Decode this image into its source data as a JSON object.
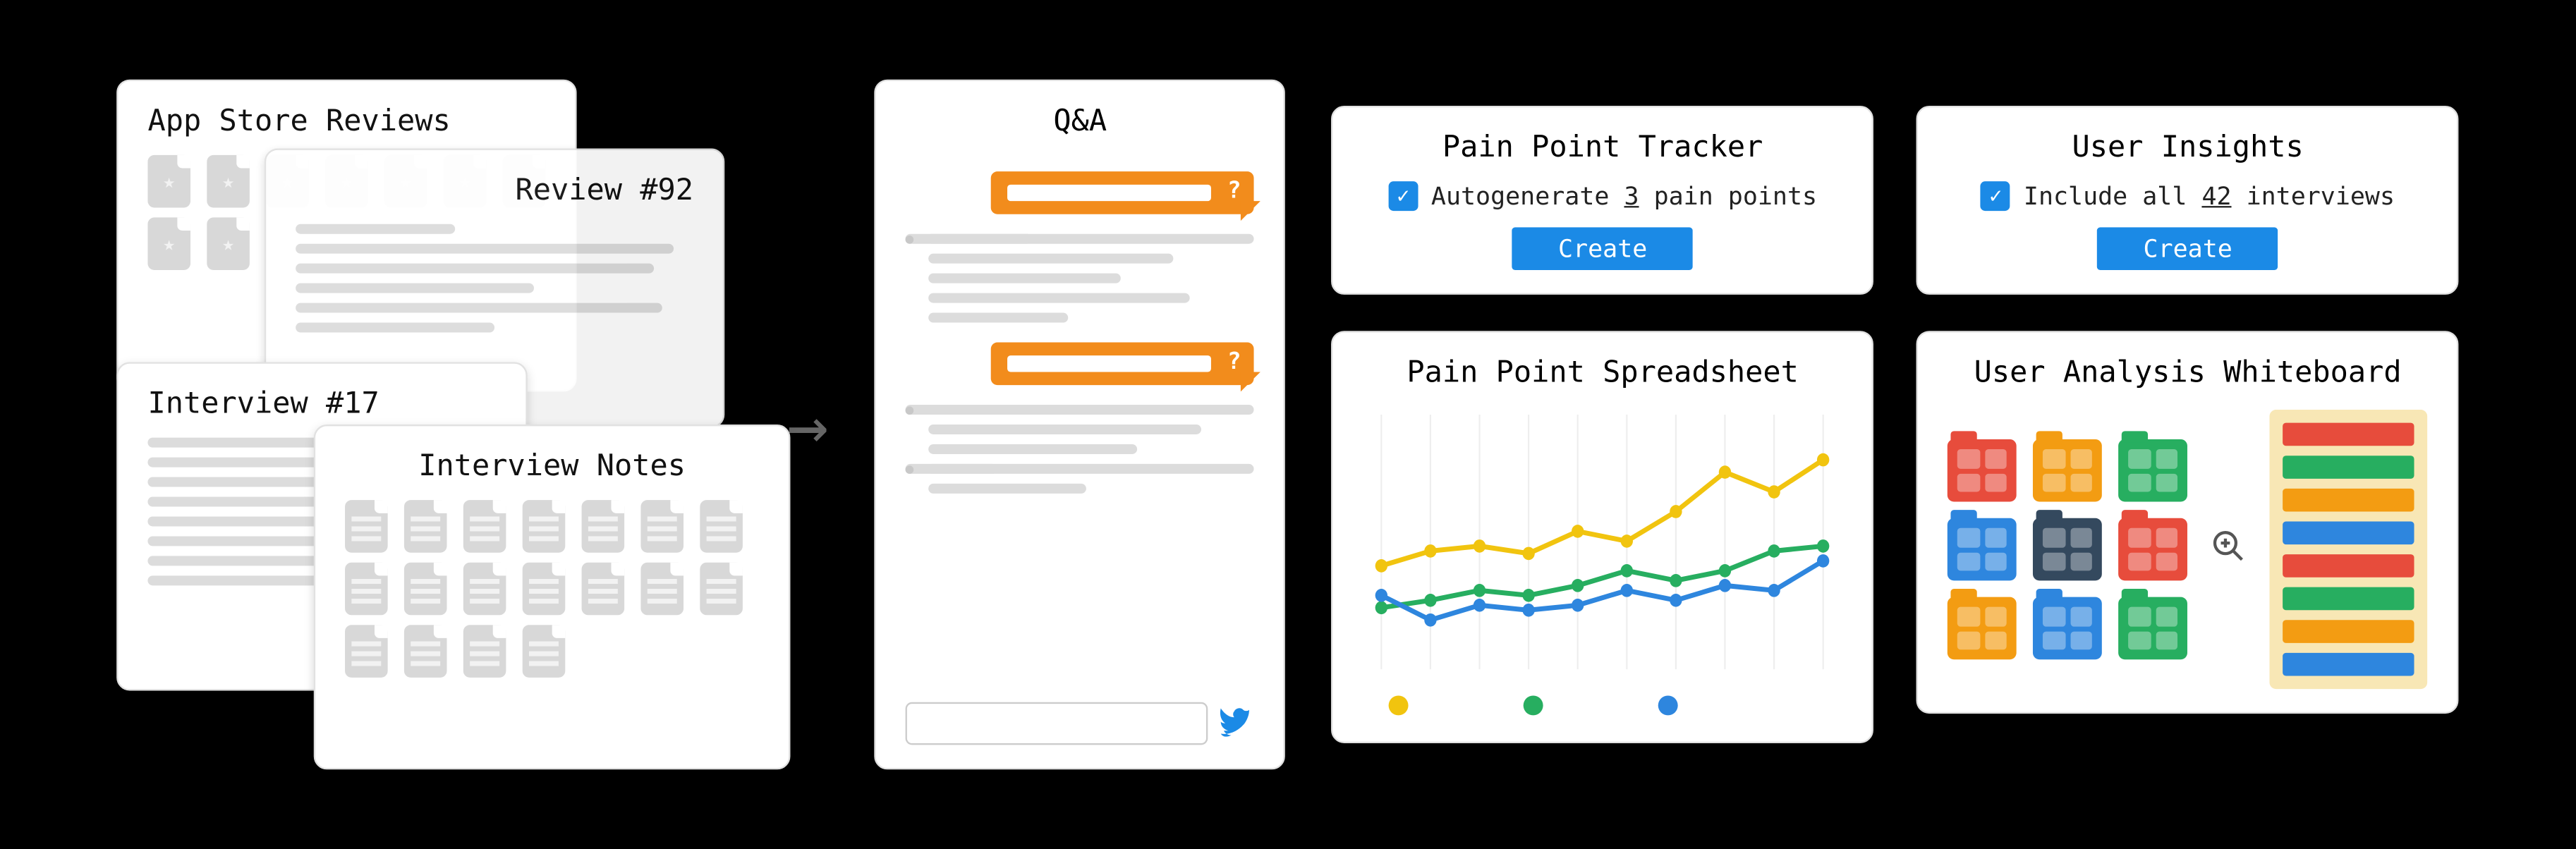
{
  "inputs": {
    "app_store_reviews": {
      "title": "App Store Reviews"
    },
    "review_92": {
      "title": "Review #92"
    },
    "interview_17": {
      "title": "Interview #17"
    },
    "interview_notes": {
      "title": "Interview Notes"
    }
  },
  "qa": {
    "title": "Q&A"
  },
  "pain_tracker": {
    "title": "Pain Point Tracker",
    "checkbox_pre": "Autogenerate ",
    "count": "3",
    "checkbox_post": " pain points",
    "button": "Create"
  },
  "user_insights": {
    "title": "User Insights",
    "checkbox_pre": "Include all ",
    "count": "42",
    "checkbox_post": " interviews",
    "button": "Create"
  },
  "spreadsheet": {
    "title": "Pain Point Spreadsheet"
  },
  "whiteboard": {
    "title": "User Analysis Whiteboard"
  },
  "chart_data": {
    "type": "line",
    "title": "Pain Point Spreadsheet",
    "xlabel": "",
    "ylabel": "",
    "x": [
      1,
      2,
      3,
      4,
      5,
      6,
      7,
      8,
      9,
      10
    ],
    "ylim": [
      0,
      100
    ],
    "series": [
      {
        "name": "yellow",
        "color": "#f1c40f",
        "values": [
          42,
          48,
          50,
          47,
          56,
          52,
          64,
          80,
          72,
          85
        ]
      },
      {
        "name": "green",
        "color": "#27ae60",
        "values": [
          25,
          28,
          32,
          30,
          34,
          40,
          36,
          40,
          48,
          50
        ]
      },
      {
        "name": "blue",
        "color": "#2e86de",
        "values": [
          30,
          20,
          26,
          24,
          26,
          32,
          28,
          34,
          32,
          44
        ]
      }
    ],
    "legend_dots": [
      "#f1c40f",
      "#27ae60",
      "#2e86de"
    ]
  },
  "whiteboard_data": {
    "folders": [
      "red",
      "orange",
      "green",
      "blue",
      "navy",
      "red",
      "orange",
      "blue",
      "green"
    ],
    "bars": [
      "#e74c3c",
      "#27ae60",
      "#f39c12",
      "#2e86de",
      "#e74c3c",
      "#27ae60",
      "#f39c12",
      "#2e86de"
    ]
  }
}
